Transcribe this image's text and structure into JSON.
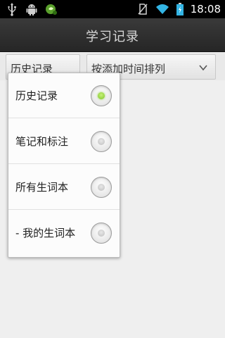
{
  "status_bar": {
    "time": "18:08",
    "left_icons": [
      "usb-icon",
      "android-debug-icon",
      "app-notification-icon"
    ],
    "right_icons": [
      "no-sim-icon",
      "wifi-icon",
      "battery-icon"
    ]
  },
  "title_bar": {
    "title": "学习记录"
  },
  "filter": {
    "left_label": "历史记录",
    "right_label": "按添加时间排列"
  },
  "dropdown": {
    "options": [
      {
        "label": "历史记录",
        "checked": true
      },
      {
        "label": "笔记和标注",
        "checked": false
      },
      {
        "label": "所有生词本",
        "checked": false
      },
      {
        "label": "- 我的生词本",
        "checked": false
      }
    ]
  },
  "colors": {
    "selected_radio": "#7cc424",
    "title_bar": "#2e2e2e",
    "background": "#efefef"
  }
}
